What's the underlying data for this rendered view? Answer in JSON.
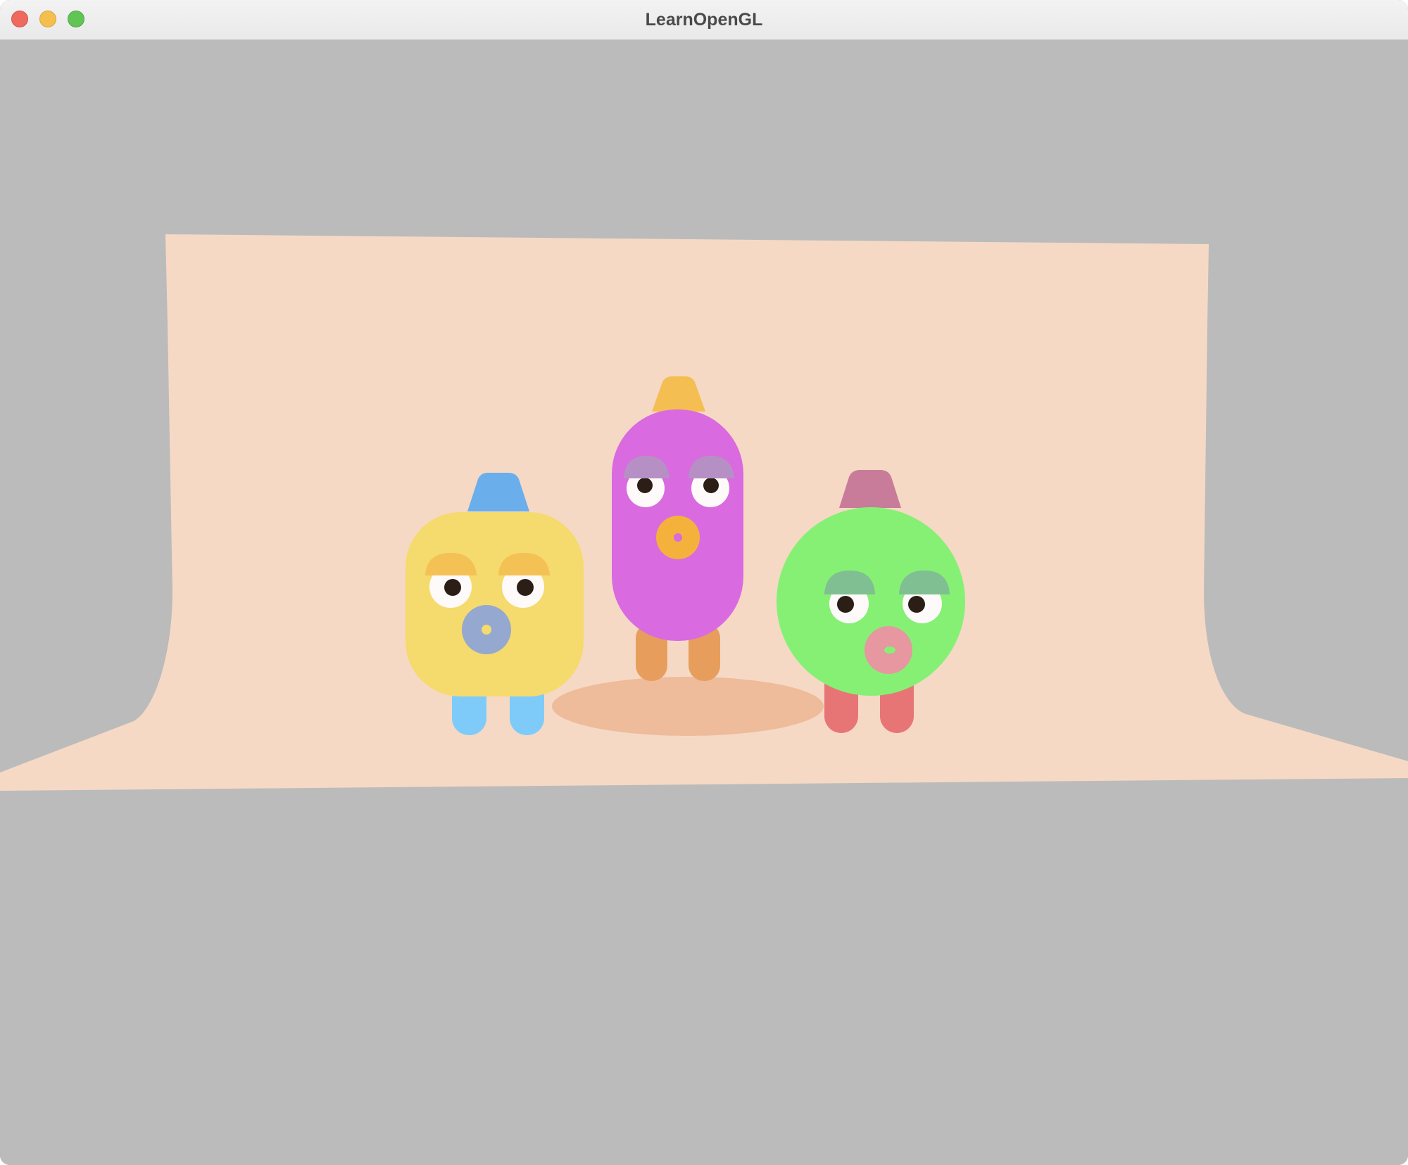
{
  "window": {
    "title": "LearnOpenGL",
    "buttons": [
      "close",
      "minimize",
      "maximize"
    ]
  },
  "colors": {
    "clear": "#bbbbbb",
    "backdrop": "#f5d9c5",
    "shadow": "#eebb9b",
    "yellow_body": "#f5da6e",
    "yellow_hat": "#6aaeec",
    "yellow_legs": "#7ecbfa",
    "yellow_mouth": "#95a8d0",
    "pink_body": "#d96ae0",
    "pink_hat": "#f4be52",
    "pink_legs": "#e79e5d",
    "pink_mouth": "#f4b23c",
    "green_body": "#86f075",
    "green_hat": "#c97b9a",
    "green_legs": "#e87576",
    "green_mouth": "#e697a0"
  },
  "scene": {
    "characters": [
      "yellow-square-character",
      "pink-capsule-character",
      "green-round-character"
    ]
  }
}
